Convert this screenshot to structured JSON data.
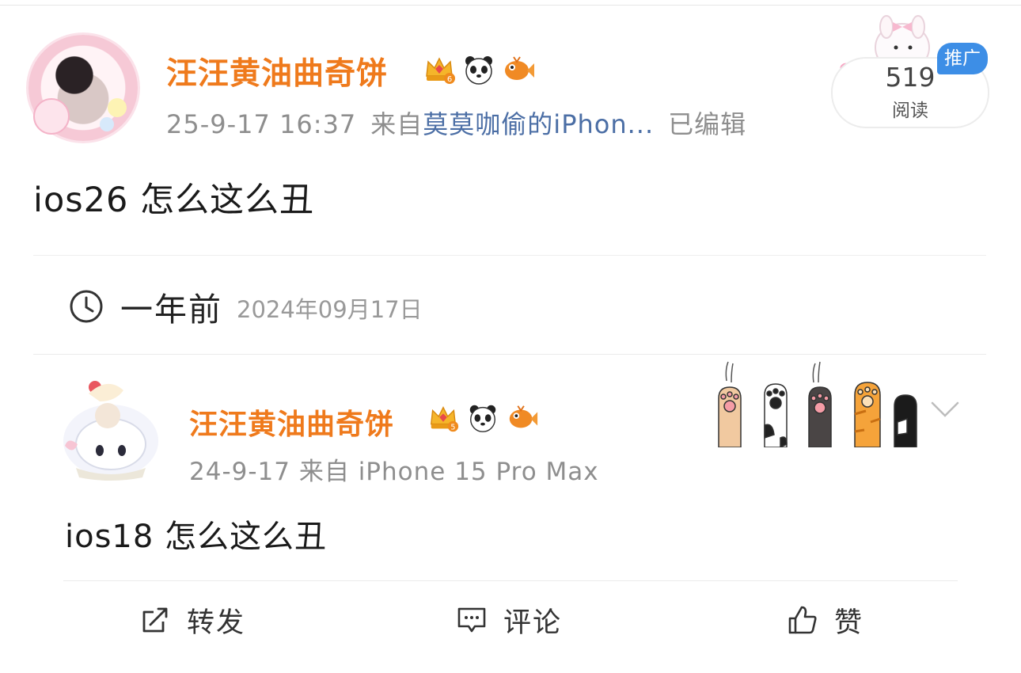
{
  "post": {
    "username": "汪汪黄油曲奇饼",
    "level_badge_text": "6",
    "meta_time": "25-9-17 16:37",
    "meta_from_prefix": "来自",
    "meta_source": "莫莫咖偷的iPhon...",
    "meta_edited": "已编辑",
    "text": "ios26 怎么这么丑",
    "read_count": "519",
    "read_label": "阅读",
    "promo_label": "推广"
  },
  "memory_card": {
    "relative_time": "一年前",
    "absolute_date": "2024年09月17日",
    "quoted": {
      "username": "汪汪黄油曲奇饼",
      "level_badge_text": "5",
      "meta": "24-9-17  来自 iPhone 15 Pro Max",
      "text": "ios18 怎么这么丑"
    },
    "actions": {
      "repost": "转发",
      "comment": "评论",
      "like": "赞"
    }
  },
  "icons": [
    "crown-badge-icon",
    "panda-icon",
    "fish-icon",
    "clock-icon",
    "chevron-down-icon",
    "repost-icon",
    "comment-icon",
    "like-icon",
    "cat-paws-sticker"
  ],
  "colors": {
    "username": "#ef7a1c",
    "source_link": "#4b6ea5",
    "promo": "#3d8ee6",
    "meta": "#8e8e8e"
  }
}
